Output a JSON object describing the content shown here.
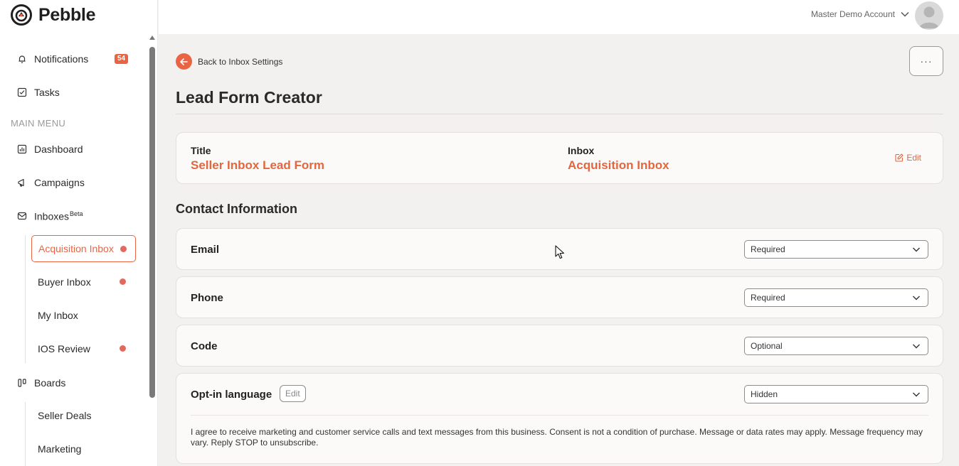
{
  "app": {
    "name": "Pebble"
  },
  "sidebar": {
    "top_items": [
      {
        "label": "Notifications",
        "icon": "bell-icon",
        "badge": "54"
      },
      {
        "label": "Tasks",
        "icon": "checkbox-icon"
      }
    ],
    "menu_heading": "MAIN MENU",
    "main_items": [
      {
        "label": "Dashboard",
        "icon": "dashboard-icon"
      },
      {
        "label": "Campaigns",
        "icon": "megaphone-icon"
      },
      {
        "label": "Inboxes",
        "icon": "inbox-icon",
        "superscript": "Beta"
      }
    ],
    "inboxes": [
      {
        "label": "Acquisition Inbox",
        "active": true,
        "unread": true
      },
      {
        "label": "Buyer Inbox",
        "active": false,
        "unread": true
      },
      {
        "label": "My Inbox",
        "active": false,
        "unread": false
      },
      {
        "label": "IOS Review",
        "active": false,
        "unread": true
      }
    ],
    "boards": {
      "label": "Boards",
      "icon": "boards-icon"
    },
    "board_items": [
      {
        "label": "Seller Deals"
      },
      {
        "label": "Marketing"
      }
    ]
  },
  "header": {
    "account_name": "Master Demo Account"
  },
  "main": {
    "back_label": "Back to Inbox Settings",
    "more_label": "···",
    "page_title": "Lead Form Creator",
    "summary": {
      "title_label": "Title",
      "title_value": "Seller Inbox Lead Form",
      "inbox_label": "Inbox",
      "inbox_value": "Acquisition Inbox",
      "edit_label": "Edit"
    },
    "section_title": "Contact Information",
    "fields": [
      {
        "label": "Email",
        "value": "Required"
      },
      {
        "label": "Phone",
        "value": "Required"
      },
      {
        "label": "Code",
        "value": "Optional"
      },
      {
        "label": "Opt-in language",
        "value": "Hidden",
        "edit_label": "Edit"
      }
    ],
    "optin_text": "I agree to receive marketing and customer service calls and text messages from this business. Consent is not a condition of purchase. Message or data rates may apply. Message frequency may vary. Reply STOP to unsubscribe."
  },
  "colors": {
    "accent": "#ea6444",
    "accent_text": "#e2673f"
  }
}
